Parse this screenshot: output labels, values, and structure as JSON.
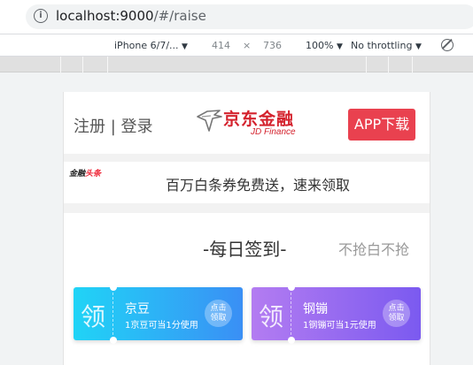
{
  "browser": {
    "url_host": "localhost:9000",
    "url_path": "/#/raise"
  },
  "device_toolbar": {
    "device": "iPhone 6/7/...",
    "width": "414",
    "times": "×",
    "height": "736",
    "zoom": "100%",
    "throttle": "No throttling"
  },
  "header": {
    "login_text": "注册 | 登录",
    "logo_cn": "京东金融",
    "logo_en": "JD Finance",
    "app_button": "APP下载"
  },
  "news": {
    "logo_a": "金融",
    "logo_b": "头条",
    "text": "百万白条券免费送，速来领取"
  },
  "signin": {
    "title": "-每日签到-",
    "subtitle": "不抢白不抢"
  },
  "coupons": [
    {
      "big": "领",
      "name": "京豆",
      "desc": "1京豆可当1分使用",
      "claim_1": "点击",
      "claim_2": "领取"
    },
    {
      "big": "领",
      "name": "钢镚",
      "desc": "1钢镚可当1元使用",
      "claim_1": "点击",
      "claim_2": "领取"
    }
  ],
  "colors": {
    "brand_red": "#d4222d",
    "app_button": "#e9414f",
    "coupon1_start": "#20d4f6",
    "coupon1_end": "#3a8ff5",
    "coupon2_start": "#b37cf1",
    "coupon2_end": "#7b5af0"
  }
}
